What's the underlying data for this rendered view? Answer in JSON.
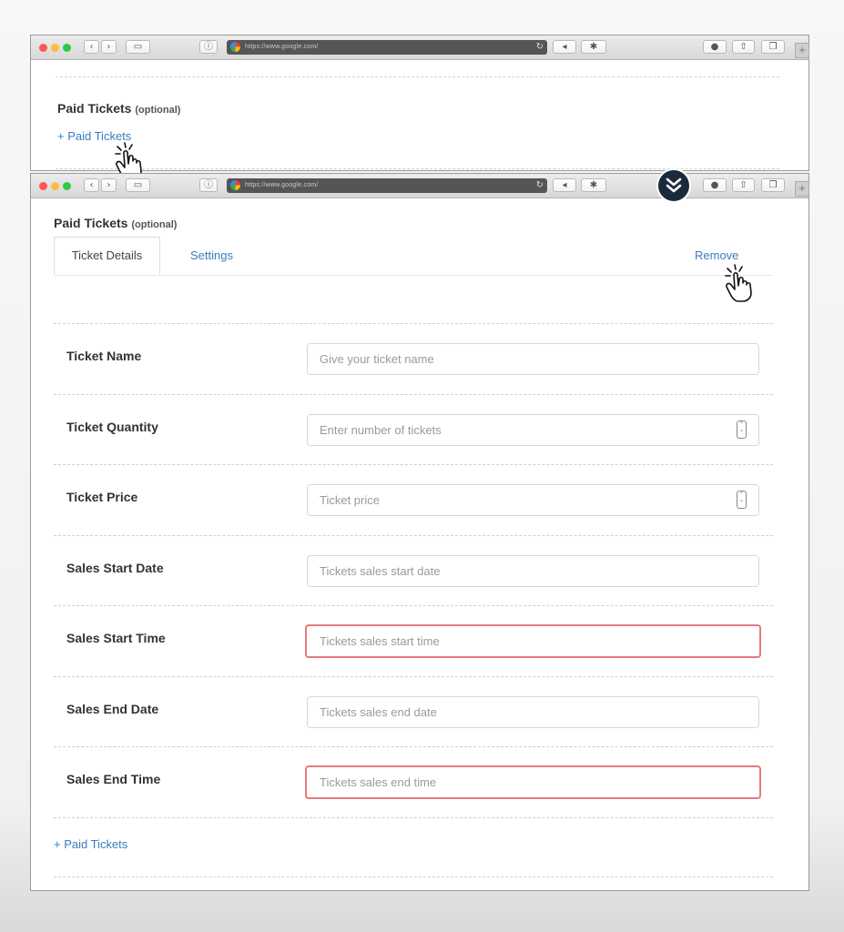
{
  "browser": {
    "url": "https://www.google.com/",
    "icons": {
      "back": "chevron-left-icon",
      "forward": "chevron-right-icon",
      "sidebar": "sidebar-icon",
      "info": "info-icon",
      "reload": "reload-icon",
      "extension": "extension-icon",
      "settings": "gear-icon",
      "download": "download-icon",
      "share": "share-icon",
      "tabs": "tabs-icon",
      "new_tab": "plus-icon"
    }
  },
  "collapsed": {
    "section_title": "Paid Tickets",
    "section_optional": "(optional)",
    "add_link": "+ Paid Tickets"
  },
  "expanded": {
    "section_title": "Paid Tickets",
    "section_optional": "(optional)",
    "tabs": [
      {
        "label": "Ticket Details",
        "active": true
      },
      {
        "label": "Settings",
        "active": false
      }
    ],
    "remove_label": "Remove",
    "fields": [
      {
        "label": "Ticket Name",
        "placeholder": "Give your ticket name",
        "error": false,
        "stepper": false
      },
      {
        "label": "Ticket Quantity",
        "placeholder": "Enter number of tickets",
        "error": false,
        "stepper": true
      },
      {
        "label": "Ticket Price",
        "placeholder": "Ticket price",
        "error": false,
        "stepper": true
      },
      {
        "label": "Sales Start Date",
        "placeholder": "Tickets sales start date",
        "error": false,
        "stepper": false
      },
      {
        "label": "Sales Start Time",
        "placeholder": "Tickets sales start time",
        "error": true,
        "stepper": false
      },
      {
        "label": "Sales End Date",
        "placeholder": "Tickets sales end date",
        "error": false,
        "stepper": false
      },
      {
        "label": "Sales End Time",
        "placeholder": "Tickets sales end time",
        "error": true,
        "stepper": false
      }
    ],
    "add_link": "+ Paid Tickets"
  },
  "colors": {
    "link": "#3a7dbf",
    "error_border": "#e7797b",
    "scroll_badge": "#1b2a3a"
  }
}
